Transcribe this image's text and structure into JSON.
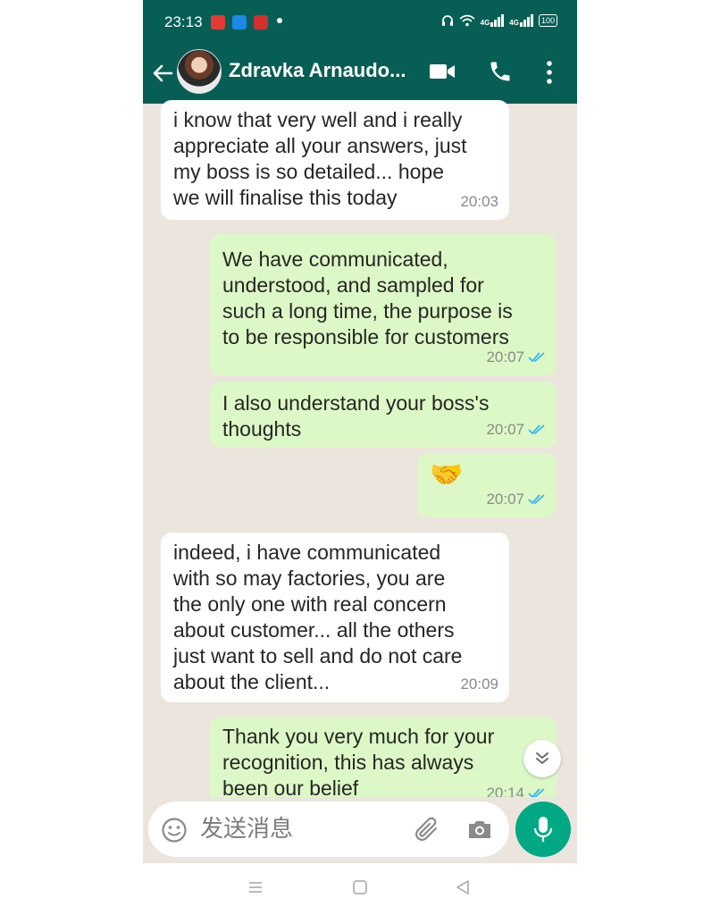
{
  "status_bar": {
    "time": "23:13",
    "apps": [
      {
        "icon": "red-app-icon",
        "color": "#e53935",
        "text": "HW"
      },
      {
        "icon": "blue-app-icon",
        "color": "#1e88e5",
        "text": ""
      },
      {
        "icon": "red-app-icon-2",
        "color": "#d32f2f",
        "text": "快"
      }
    ],
    "signal_label": "4G",
    "battery": "100"
  },
  "header": {
    "contact_name": "Zdravka Arnaudo...",
    "color": "#075e54"
  },
  "messages": [
    {
      "direction": "incoming",
      "text": "i know that very well and i really\nappreciate all your answers, just\nmy boss is so detailed... hope\nwe will finalise this today",
      "time": "20:03"
    },
    {
      "direction": "outgoing",
      "text": "We have communicated,\nunderstood, and sampled for\nsuch a long time, the purpose is\nto be responsible for customers",
      "time": "20:07",
      "read": true
    },
    {
      "direction": "outgoing",
      "text": "I also understand your boss's\nthoughts",
      "time": "20:07",
      "read": true
    },
    {
      "direction": "outgoing",
      "text": "🤝",
      "time": "20:07",
      "read": true
    },
    {
      "direction": "incoming",
      "text": "indeed, i have communicated\nwith so may factories, you are\nthe only one with real concern\nabout customer... all the others\njust want to sell and do not care\nabout the client...",
      "time": "20:09"
    },
    {
      "direction": "outgoing",
      "text": "Thank you very much for your\nrecognition, this has always\nbeen our belief",
      "time": "20:14",
      "read": true
    }
  ],
  "composer": {
    "placeholder": "发送消息"
  },
  "colors": {
    "outgoing_bubble": "#dcf8c6",
    "incoming_bubble": "#ffffff",
    "chat_background": "#ece5dd",
    "accent": "#00a884",
    "read_ticks": "#34b7f1"
  }
}
